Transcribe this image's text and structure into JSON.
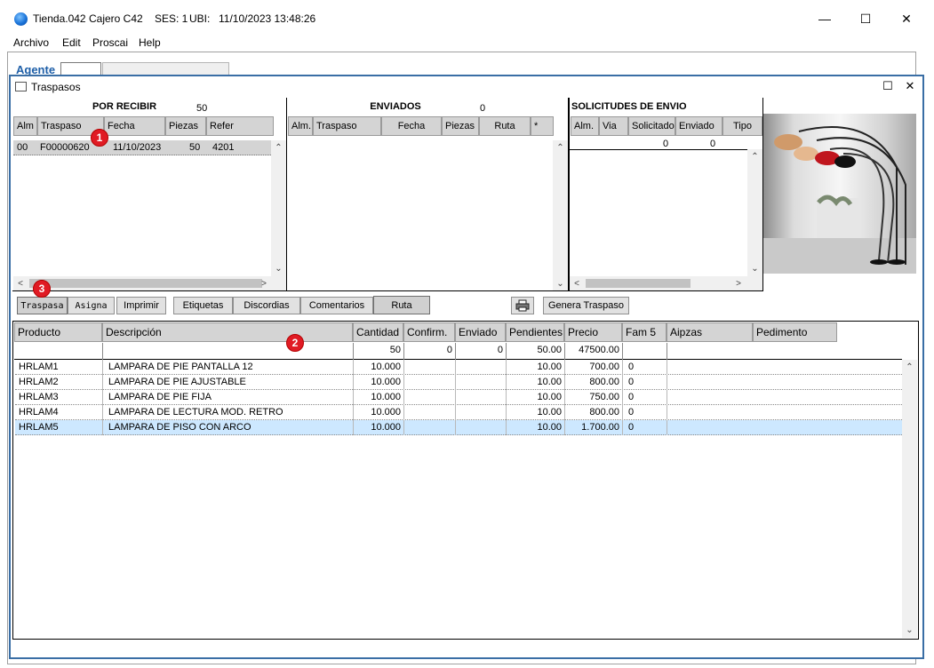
{
  "titlebar": {
    "store": "Tienda.042",
    "cashier": "Cajero C42",
    "session": "SES: 1",
    "location_label": "UBI:",
    "datetime": "11/10/2023 13:48:26"
  },
  "window_controls": {
    "minimize": "—",
    "maximize": "☐",
    "close": "✕"
  },
  "menu": [
    "Archivo",
    "Edit",
    "Proscai",
    "Help"
  ],
  "agente": {
    "label": "Agente"
  },
  "child_window": {
    "title": "Traspasos",
    "maximize": "☐",
    "close": "✕"
  },
  "por_recibir": {
    "title": "POR RECIBIR",
    "total": "50",
    "columns": [
      "Alm",
      "Traspaso",
      "Fecha",
      "Piezas",
      "Refer"
    ],
    "rows": [
      {
        "alm": "00",
        "traspaso": "F00000620",
        "fecha": "11/10/2023",
        "piezas": "50",
        "refer": "4201"
      }
    ]
  },
  "enviados": {
    "title": "ENVIADOS",
    "total": "0",
    "columns": [
      "Alm.",
      "Traspaso",
      "Fecha",
      "Piezas",
      "Ruta",
      "*"
    ]
  },
  "solicitudes": {
    "title": "SOLICITUDES DE ENVIO",
    "columns": [
      "Alm.",
      "Via",
      "Solicitado",
      "Enviado",
      "Tipo"
    ],
    "total_solicitado": "0",
    "total_enviado": "0"
  },
  "markers": [
    "1",
    "2",
    "3"
  ],
  "buttons": {
    "traspasa": "Traspasa",
    "asigna": "Asigna",
    "imprimir": "Imprimir",
    "etiquetas": "Etiquetas",
    "discordias": "Discordias",
    "comentarios": "Comentarios",
    "ruta": "Ruta",
    "print_icon": "printer-icon",
    "genera_traspaso": "Genera Traspaso"
  },
  "grid": {
    "columns": [
      "Producto",
      "Descripción",
      "Cantidad",
      "Confirm.",
      "Enviado",
      "Pendientes",
      "Precio",
      "Fam 5",
      "Aipzas",
      "Pedimento"
    ],
    "totals": {
      "cantidad": "50",
      "confirm": "0",
      "enviado": "0",
      "pendientes": "50.00",
      "precio": "47500.00"
    },
    "rows": [
      {
        "producto": "HRLAM1",
        "descripcion": "LAMPARA DE PIE PANTALLA 12",
        "cantidad": "10.000",
        "pendientes": "10.00",
        "precio": "700.00",
        "fam5": "0"
      },
      {
        "producto": "HRLAM2",
        "descripcion": "LAMPARA DE PIE AJUSTABLE",
        "cantidad": "10.000",
        "pendientes": "10.00",
        "precio": "800.00",
        "fam5": "0"
      },
      {
        "producto": "HRLAM3",
        "descripcion": "LAMPARA DE PIE FIJA",
        "cantidad": "10.000",
        "pendientes": "10.00",
        "precio": "750.00",
        "fam5": "0"
      },
      {
        "producto": "HRLAM4",
        "descripcion": "LAMPARA DE LECTURA MOD. RETRO",
        "cantidad": "10.000",
        "pendientes": "10.00",
        "precio": "800.00",
        "fam5": "0"
      },
      {
        "producto": "HRLAM5",
        "descripcion": "LAMPARA DE PISO CON ARCO",
        "cantidad": "10.000",
        "pendientes": "10.00",
        "precio": "1.700.00",
        "fam5": "0"
      }
    ],
    "selected_row": 4
  },
  "colors": {
    "accent": "#3a6ea5",
    "agente_label": "#1e5fa8",
    "selected_row": "#cde8ff",
    "badge": "#e01b24"
  }
}
